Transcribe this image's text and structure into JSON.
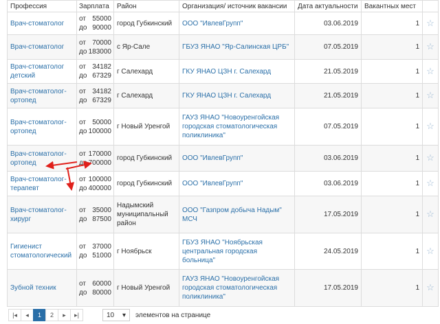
{
  "columns": [
    "Профессия",
    "Зарплата",
    "Район",
    "Организация/ источник вакансии",
    "Дата актуальности",
    "Вакантных мест"
  ],
  "rows": [
    {
      "profession": "Врач-стоматолог",
      "sal_from": "55000",
      "sal_to": "90000",
      "region": "город Губкинский",
      "org": "ООО \"ИвлевГрупп\"",
      "date": "03.06.2019",
      "vacancies": "1"
    },
    {
      "profession": "Врач-стоматолог",
      "sal_from": "70000",
      "sal_to": "183000",
      "region": "с Яр-Сале",
      "org": "ГБУЗ ЯНАО \"Яр-Салинская ЦРБ\"",
      "date": "07.05.2019",
      "vacancies": "1"
    },
    {
      "profession": "Врач-стоматолог детский",
      "sal_from": "34182",
      "sal_to": "67329",
      "region": "г Салехард",
      "org": "ГКУ ЯНАО ЦЗН г. Салехард",
      "date": "21.05.2019",
      "vacancies": "1"
    },
    {
      "profession": "Врач-стоматолог-ортопед",
      "sal_from": "34182",
      "sal_to": "67329",
      "region": "г Салехард",
      "org": "ГКУ ЯНАО ЦЗН г. Салехард",
      "date": "21.05.2019",
      "vacancies": "1"
    },
    {
      "profession": "Врач-стоматолог-ортопед",
      "sal_from": "50000",
      "sal_to": "100000",
      "region": "г Новый Уренгой",
      "org": "ГАУЗ ЯНАО \"Новоуренгойская городская стоматологическая поликлиника\"",
      "date": "07.05.2019",
      "vacancies": "1"
    },
    {
      "profession": "Врач-стоматолог-ортопед",
      "sal_from": "170000",
      "sal_to": "700000",
      "region": "город Губкинский",
      "org": "ООО \"ИвлевГрупп\"",
      "date": "03.06.2019",
      "vacancies": "1"
    },
    {
      "profession": "Врач-стоматолог-терапевт",
      "sal_from": "100000",
      "sal_to": "400000",
      "region": "город Губкинский",
      "org": "ООО \"ИвлевГрупп\"",
      "date": "03.06.2019",
      "vacancies": "1"
    },
    {
      "profession": "Врач-стоматолог-хирург",
      "sal_from": "35000",
      "sal_to": "87500",
      "region": "Надымский муниципальный район",
      "org": "ООО \"Газпром добыча Надым\" МСЧ",
      "date": "17.05.2019",
      "vacancies": "1"
    },
    {
      "profession": "Гигиенист стоматологический",
      "sal_from": "37000",
      "sal_to": "51000",
      "region": "г Ноябрьск",
      "org": "ГБУЗ ЯНАО \"Ноябрьская центральная городская больница\"",
      "date": "24.05.2019",
      "vacancies": "1"
    },
    {
      "profession": "Зубной техник",
      "sal_from": "60000",
      "sal_to": "80000",
      "region": "г Новый Уренгой",
      "org": "ГАУЗ ЯНАО \"Новоуренгойская городская стоматологическая поликлиника\"",
      "date": "17.05.2019",
      "vacancies": "1"
    }
  ],
  "salary_prefix_from": "от",
  "salary_prefix_to": "до",
  "favorite_icon": "☆",
  "pagination": {
    "first": "|◂",
    "prev": "◂",
    "pages": [
      "1",
      "2"
    ],
    "current_page": "1",
    "next": "▸",
    "last": "▸|",
    "page_size": "10",
    "page_size_caret": "▾",
    "page_size_label": "элементов на странице"
  },
  "colors": {
    "link": "#2a6fa8",
    "arrow": "#e0201b",
    "active_page": "#2a6fa8"
  }
}
